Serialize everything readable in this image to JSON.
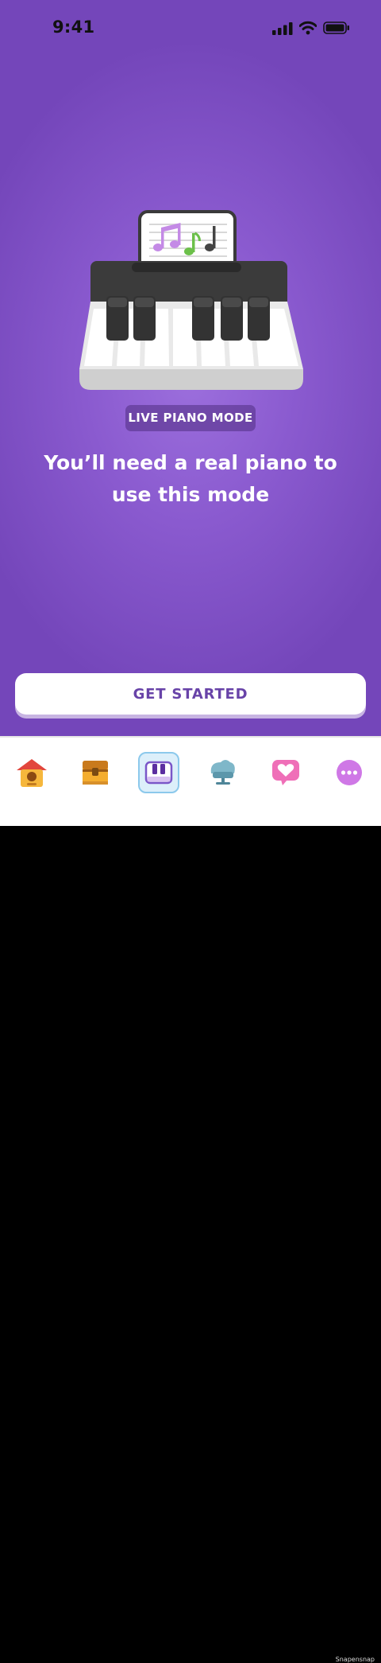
{
  "status_bar": {
    "time": "9:41"
  },
  "hero": {
    "badge": "LIVE PIANO MODE",
    "headline": "You’ll need a real piano to use this mode"
  },
  "cta": {
    "label": "GET STARTED"
  },
  "tabs": [
    {
      "icon": "home-icon",
      "selected": false
    },
    {
      "icon": "treasure-chest-icon",
      "selected": false
    },
    {
      "icon": "piano-keys-icon",
      "selected": true
    },
    {
      "icon": "grand-piano-icon",
      "selected": false
    },
    {
      "icon": "heart-message-icon",
      "selected": false
    },
    {
      "icon": "more-icon",
      "selected": false
    }
  ],
  "watermark": "Snapensnap",
  "colors": {
    "accent": "#7446ba",
    "cta_text": "#6843a8",
    "active_tab": "#8cc9ec"
  }
}
